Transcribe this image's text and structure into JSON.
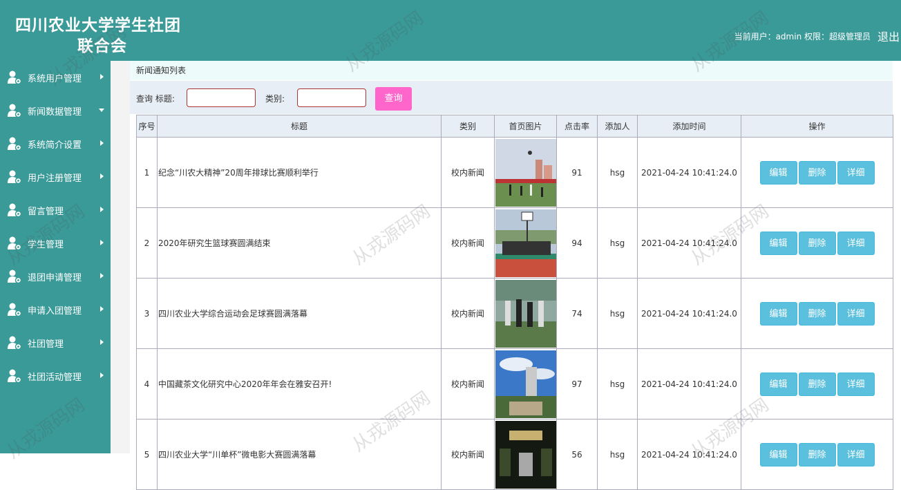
{
  "header": {
    "title_line1": "四川农业大学学生社团",
    "title_line2": "联合会",
    "user_info": "当前用户：admin 权限：超级管理员",
    "logout": "退出"
  },
  "sidebar": {
    "items": [
      {
        "label": "系统用户管理",
        "expanded": false
      },
      {
        "label": "新闻数据管理",
        "expanded": true
      },
      {
        "label": "系统简介设置",
        "expanded": false
      },
      {
        "label": "用户注册管理",
        "expanded": false
      },
      {
        "label": "留言管理",
        "expanded": false
      },
      {
        "label": "学生管理",
        "expanded": false
      },
      {
        "label": "退团申请管理",
        "expanded": false
      },
      {
        "label": "申请入团管理",
        "expanded": false
      },
      {
        "label": "社团管理",
        "expanded": false
      },
      {
        "label": "社团活动管理",
        "expanded": false
      }
    ]
  },
  "breadcrumb": "新闻通知列表",
  "search": {
    "query_label": "查询 标题:",
    "title_value": "",
    "category_label": "类别:",
    "category_value": "",
    "button": "查询"
  },
  "table": {
    "headers": [
      "序号",
      "标题",
      "类别",
      "首页图片",
      "点击率",
      "添加人",
      "添加时间",
      "操作"
    ],
    "rows": [
      {
        "no": "1",
        "title": "纪念“川农大精神”20周年排球比赛顺利举行",
        "category": "校内新闻",
        "clicks": "91",
        "author": "hsg",
        "time": "2021-04-24 10:41:24.0"
      },
      {
        "no": "2",
        "title": "2020年研究生篮球赛圆满结束",
        "category": "校内新闻",
        "clicks": "94",
        "author": "hsg",
        "time": "2021-04-24 10:41:24.0"
      },
      {
        "no": "3",
        "title": "四川农业大学综合运动会足球赛圆满落幕",
        "category": "校内新闻",
        "clicks": "74",
        "author": "hsg",
        "time": "2021-04-24 10:41:24.0"
      },
      {
        "no": "4",
        "title": "中国藏茶文化研究中心2020年年会在雅安召开!",
        "category": "校内新闻",
        "clicks": "97",
        "author": "hsg",
        "time": "2021-04-24 10:41:24.0"
      },
      {
        "no": "5",
        "title": "四川农业大学“川单杯”微电影大赛圆满落幕",
        "category": "校内新闻",
        "clicks": "56",
        "author": "hsg",
        "time": "2021-04-24 10:41:24.0"
      }
    ],
    "actions": {
      "edit": "编辑",
      "delete": "删除",
      "detail": "详细"
    }
  },
  "watermark": "从戎源码网",
  "colors": {
    "brand": "#3a9a98",
    "search_button": "#ff66cc",
    "action_button": "#5bc0de"
  }
}
